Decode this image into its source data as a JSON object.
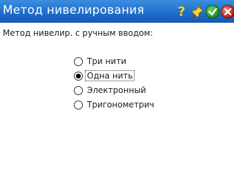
{
  "window": {
    "title": "Метод нивелирования",
    "icons": [
      "help-icon",
      "pin-icon",
      "ok-icon",
      "close-icon"
    ],
    "title_bg": "#1f6fcc",
    "title_fg": "#ffffff"
  },
  "form": {
    "prompt": "Метод нивелир. с ручным вводом:",
    "options": [
      {
        "label": "Три нити",
        "selected": false
      },
      {
        "label": "Одна нить",
        "selected": true
      },
      {
        "label": "Электронный",
        "selected": false
      },
      {
        "label": "Тригонометрич",
        "selected": false
      }
    ]
  }
}
